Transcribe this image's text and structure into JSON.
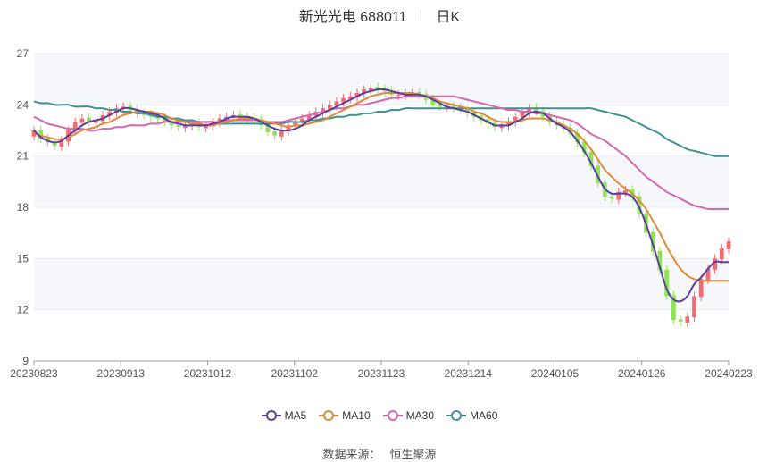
{
  "header": {
    "title": "新光光电 688011",
    "period": "日K"
  },
  "legend": [
    {
      "label": "MA5",
      "color": "#5b3f9e"
    },
    {
      "label": "MA10",
      "color": "#dc8a3c"
    },
    {
      "label": "MA30",
      "color": "#d367b0"
    },
    {
      "label": "MA60",
      "color": "#3f9090"
    }
  ],
  "source": {
    "label": "数据来源：",
    "value": "恒生聚源"
  },
  "colors": {
    "up": "#f26d73",
    "down": "#8ee657",
    "grid": "#e8ebf3",
    "band": "#f6f7fb"
  },
  "chart_data": {
    "type": "candlestick",
    "title": "新光光电 688011",
    "ylim": [
      9,
      27
    ],
    "yticks": [
      9,
      12,
      15,
      18,
      21,
      24,
      27
    ],
    "xticks": [
      "20230823",
      "20230913",
      "20231012",
      "20231102",
      "20231123",
      "20231214",
      "20240105",
      "20240126",
      "20240223"
    ],
    "close": [
      22.5,
      22.0,
      21.8,
      21.6,
      21.9,
      22.5,
      23.0,
      23.2,
      23.0,
      23.1,
      23.4,
      23.6,
      23.8,
      23.9,
      23.7,
      23.5,
      23.4,
      23.3,
      23.2,
      23.0,
      22.8,
      22.7,
      22.8,
      22.9,
      22.7,
      22.8,
      23.0,
      23.2,
      23.3,
      23.4,
      23.3,
      23.2,
      23.1,
      22.8,
      22.4,
      22.2,
      22.5,
      22.8,
      23.0,
      23.2,
      23.4,
      23.6,
      23.8,
      24.0,
      24.2,
      24.4,
      24.5,
      24.7,
      24.9,
      25.0,
      24.9,
      24.8,
      24.6,
      24.6,
      24.7,
      24.7,
      24.6,
      24.3,
      24.0,
      23.9,
      23.9,
      23.8,
      23.7,
      23.5,
      23.3,
      23.1,
      22.9,
      22.7,
      22.8,
      23.0,
      23.3,
      23.6,
      23.8,
      23.6,
      23.3,
      23.0,
      22.8,
      22.6,
      22.3,
      21.8,
      21.2,
      20.4,
      19.4,
      18.6,
      18.5,
      18.9,
      19.0,
      18.6,
      17.6,
      16.5,
      15.4,
      14.3,
      12.8,
      11.4,
      11.3,
      11.6,
      12.8,
      13.8,
      14.4,
      15.0,
      15.6,
      16.0
    ],
    "ma5": [
      22.5,
      22.1,
      21.9,
      21.8,
      21.9,
      22.2,
      22.5,
      22.8,
      23.0,
      23.1,
      23.2,
      23.4,
      23.6,
      23.8,
      23.8,
      23.7,
      23.6,
      23.5,
      23.4,
      23.2,
      23.0,
      22.9,
      22.8,
      22.8,
      22.8,
      22.8,
      22.9,
      23.0,
      23.2,
      23.3,
      23.3,
      23.3,
      23.2,
      23.0,
      22.8,
      22.6,
      22.5,
      22.5,
      22.6,
      22.8,
      23.1,
      23.3,
      23.5,
      23.7,
      23.9,
      24.1,
      24.3,
      24.5,
      24.7,
      24.8,
      24.9,
      24.9,
      24.8,
      24.7,
      24.6,
      24.6,
      24.6,
      24.5,
      24.3,
      24.1,
      23.9,
      23.8,
      23.7,
      23.6,
      23.4,
      23.2,
      23.0,
      22.8,
      22.8,
      22.8,
      23.0,
      23.2,
      23.5,
      23.6,
      23.5,
      23.2,
      22.9,
      22.7,
      22.4,
      21.9,
      21.3,
      20.6,
      19.8,
      19.1,
      18.8,
      18.8,
      18.8,
      18.6,
      18.0,
      17.0,
      15.8,
      14.5,
      13.2,
      12.6,
      12.5,
      12.8,
      13.5,
      13.9,
      14.4,
      14.8,
      14.8,
      14.8
    ],
    "ma10": [
      22.4,
      22.2,
      22.1,
      22.0,
      22.0,
      22.1,
      22.3,
      22.5,
      22.6,
      22.7,
      22.9,
      23.0,
      23.2,
      23.4,
      23.5,
      23.6,
      23.6,
      23.6,
      23.5,
      23.4,
      23.2,
      23.1,
      23.0,
      22.9,
      22.9,
      22.8,
      22.8,
      22.9,
      23.0,
      23.1,
      23.2,
      23.2,
      23.2,
      23.1,
      23.0,
      22.9,
      22.8,
      22.7,
      22.8,
      22.8,
      22.9,
      23.0,
      23.1,
      23.3,
      23.5,
      23.7,
      23.9,
      24.1,
      24.3,
      24.5,
      24.6,
      24.7,
      24.7,
      24.7,
      24.7,
      24.7,
      24.6,
      24.5,
      24.4,
      24.2,
      24.1,
      24.0,
      23.9,
      23.8,
      23.6,
      23.5,
      23.3,
      23.1,
      23.0,
      23.0,
      23.0,
      23.1,
      23.2,
      23.2,
      23.2,
      23.1,
      23.0,
      22.8,
      22.6,
      22.3,
      21.9,
      21.4,
      20.8,
      20.2,
      19.8,
      19.4,
      19.1,
      18.8,
      18.4,
      17.9,
      17.2,
      16.5,
      15.7,
      15.0,
      14.4,
      14.0,
      13.8,
      13.7,
      13.7,
      13.7,
      13.7,
      13.7
    ],
    "ma30": [
      23.3,
      23.1,
      22.9,
      22.8,
      22.7,
      22.6,
      22.6,
      22.6,
      22.5,
      22.5,
      22.6,
      22.6,
      22.7,
      22.7,
      22.8,
      22.8,
      22.8,
      22.9,
      22.9,
      23.0,
      23.0,
      23.0,
      23.0,
      23.0,
      23.0,
      23.0,
      23.0,
      23.0,
      23.1,
      23.1,
      23.1,
      23.1,
      23.1,
      23.1,
      23.0,
      23.0,
      23.0,
      23.1,
      23.2,
      23.3,
      23.4,
      23.5,
      23.6,
      23.7,
      23.8,
      23.8,
      23.9,
      24.0,
      24.0,
      24.1,
      24.2,
      24.3,
      24.4,
      24.4,
      24.5,
      24.5,
      24.5,
      24.5,
      24.5,
      24.5,
      24.5,
      24.5,
      24.4,
      24.3,
      24.2,
      24.1,
      24.0,
      23.9,
      23.8,
      23.7,
      23.7,
      23.6,
      23.6,
      23.5,
      23.5,
      23.4,
      23.3,
      23.2,
      23.1,
      22.9,
      22.6,
      22.3,
      22.1,
      21.9,
      21.6,
      21.3,
      21.0,
      20.6,
      20.2,
      19.8,
      19.5,
      19.2,
      18.9,
      18.7,
      18.5,
      18.3,
      18.1,
      18.0,
      17.9,
      17.9,
      17.9,
      17.9
    ],
    "ma60": [
      24.2,
      24.1,
      24.1,
      24.0,
      24.0,
      24.0,
      23.9,
      23.9,
      23.9,
      23.8,
      23.8,
      23.7,
      23.7,
      23.6,
      23.6,
      23.5,
      23.5,
      23.4,
      23.3,
      23.3,
      23.2,
      23.2,
      23.1,
      23.1,
      23.0,
      23.0,
      23.0,
      22.9,
      22.9,
      22.9,
      22.9,
      22.9,
      22.9,
      22.9,
      22.9,
      22.9,
      22.9,
      23.0,
      23.0,
      23.0,
      23.1,
      23.1,
      23.2,
      23.2,
      23.3,
      23.3,
      23.4,
      23.4,
      23.5,
      23.5,
      23.6,
      23.6,
      23.7,
      23.7,
      23.8,
      23.8,
      23.8,
      23.8,
      23.8,
      23.8,
      23.8,
      23.8,
      23.8,
      23.8,
      23.8,
      23.8,
      23.8,
      23.8,
      23.8,
      23.8,
      23.8,
      23.8,
      23.8,
      23.8,
      23.8,
      23.8,
      23.8,
      23.8,
      23.8,
      23.8,
      23.8,
      23.8,
      23.7,
      23.6,
      23.5,
      23.4,
      23.3,
      23.1,
      22.9,
      22.7,
      22.5,
      22.3,
      22.0,
      21.8,
      21.6,
      21.4,
      21.3,
      21.2,
      21.1,
      21.0,
      21.0,
      21.0
    ]
  }
}
